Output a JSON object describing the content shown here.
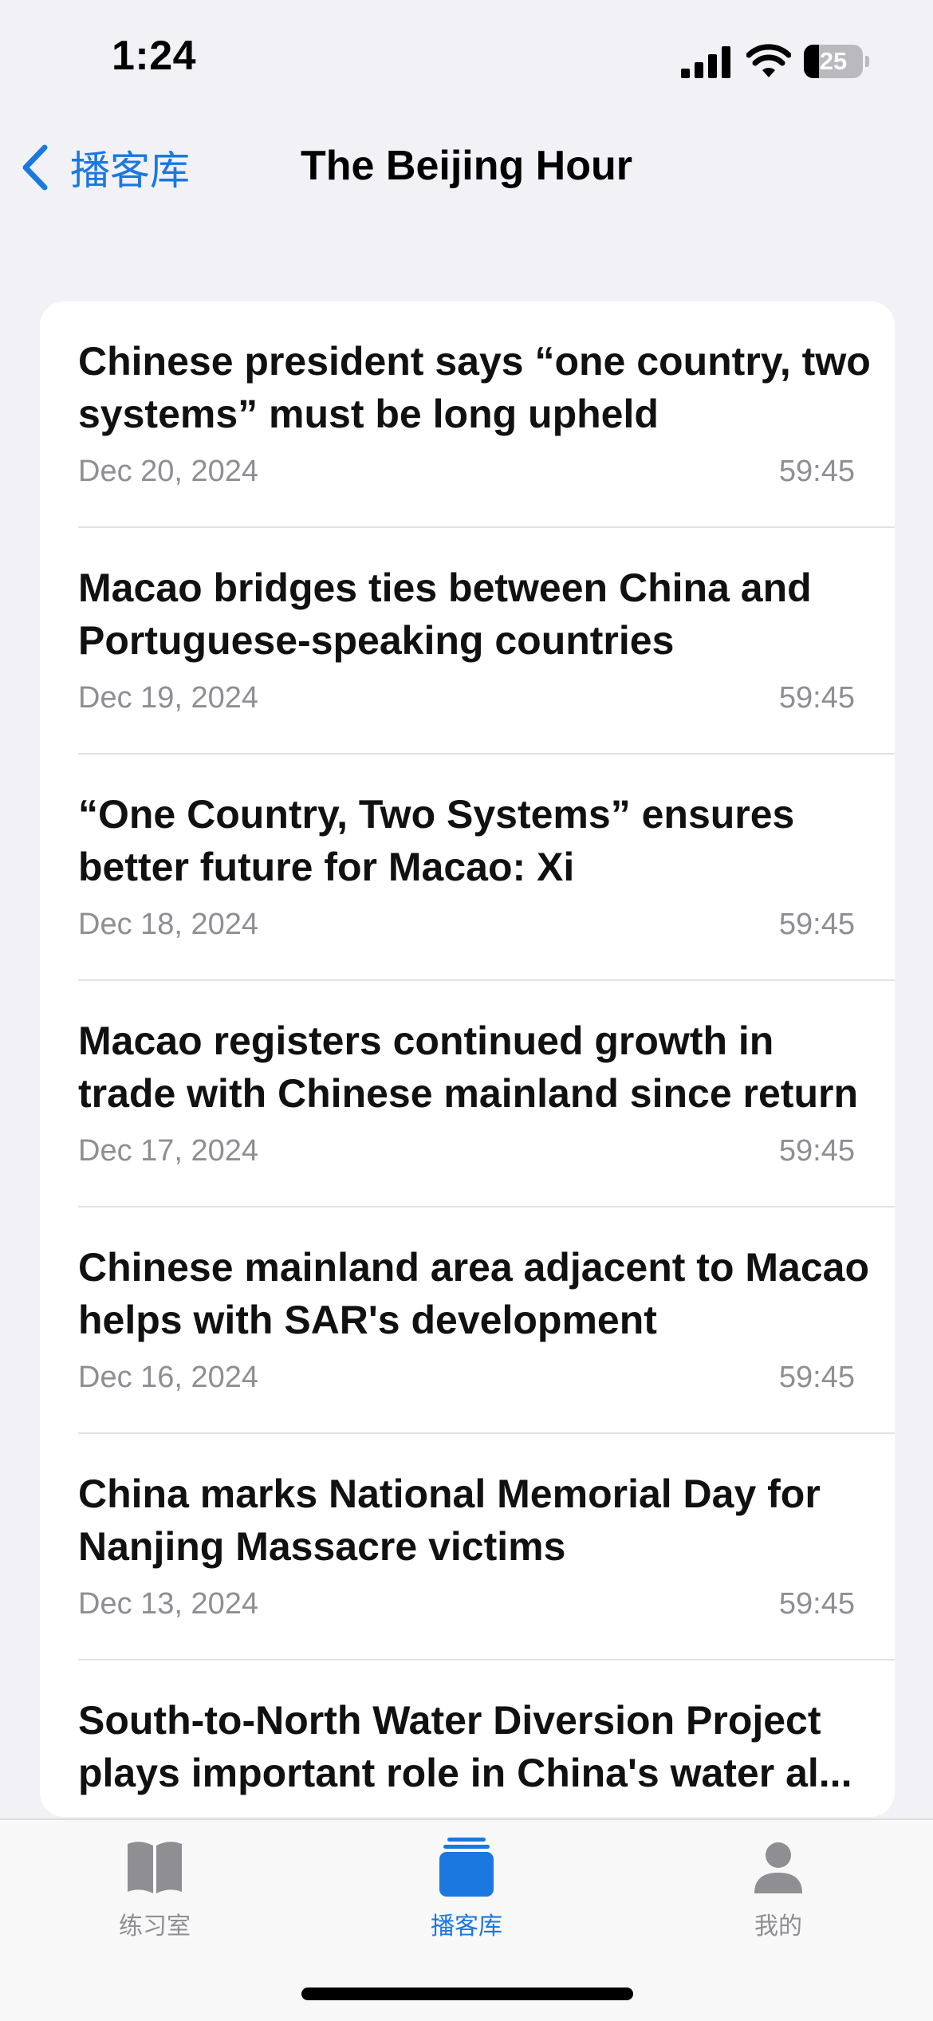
{
  "status_bar": {
    "time": "1:24",
    "battery": "25",
    "battery_level_percent": 25
  },
  "nav": {
    "back_label": "播客库",
    "title": "The Beijing Hour"
  },
  "episodes": [
    {
      "title": "Chinese president says “one country, two systems” must be long upheld",
      "date": "Dec 20, 2024",
      "duration": "59:45"
    },
    {
      "title": "Macao bridges ties between China and Portuguese-speaking countries",
      "date": "Dec 19, 2024",
      "duration": "59:45"
    },
    {
      "title": "“One Country, Two Systems” ensures better future for Macao: Xi",
      "date": "Dec 18, 2024",
      "duration": "59:45"
    },
    {
      "title": "Macao registers continued growth in trade with Chinese mainland since return",
      "date": "Dec 17, 2024",
      "duration": "59:45"
    },
    {
      "title": "Chinese mainland area adjacent to Macao helps with SAR's development",
      "date": "Dec 16, 2024",
      "duration": "59:45"
    },
    {
      "title": "China marks National Memorial Day for Nanjing Massacre victims",
      "date": "Dec 13, 2024",
      "duration": "59:45"
    },
    {
      "title": "South-to-North Water Diversion Project plays important role in China's water al...",
      "date": "",
      "duration": ""
    }
  ],
  "tabs": [
    {
      "label": "练习室",
      "icon": "book-icon",
      "active": false
    },
    {
      "label": "播客库",
      "icon": "library-icon",
      "active": true
    },
    {
      "label": "我的",
      "icon": "person-icon",
      "active": false
    }
  ],
  "colors": {
    "accent": "#1A78E0",
    "inactive": "#8E8E93",
    "background": "#F1F1F6"
  }
}
